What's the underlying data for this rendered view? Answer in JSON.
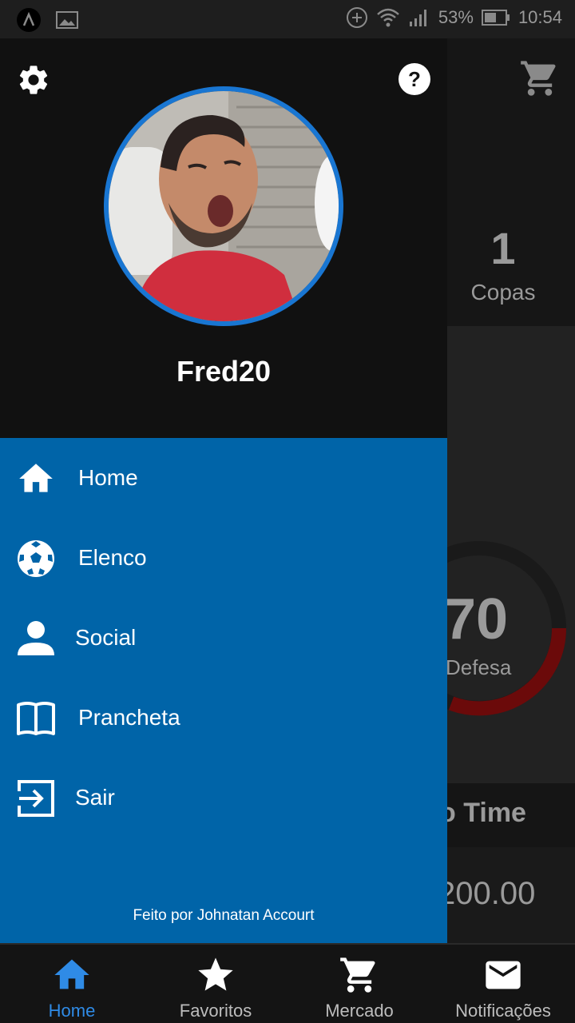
{
  "status_bar": {
    "battery": "53%",
    "time": "10:54"
  },
  "background": {
    "copas_count": "1",
    "copas_label": "Copas",
    "gauge_value": "70",
    "gauge_label": "Defesa",
    "section_title": "o Time",
    "amount": "200.00",
    "gauge_color": "#8b0000"
  },
  "drawer": {
    "username": "Fred20",
    "avatar_border_color": "#1976d2",
    "menu": [
      {
        "label": "Home",
        "icon": "home-icon"
      },
      {
        "label": "Elenco",
        "icon": "soccer-ball-icon"
      },
      {
        "label": "Social",
        "icon": "person-icon"
      },
      {
        "label": "Prancheta",
        "icon": "book-icon"
      },
      {
        "label": "Sair",
        "icon": "exit-icon"
      }
    ],
    "credit": "Feito por Johnatan Accourt",
    "menu_bg_color": "#0064a8"
  },
  "bottom_nav": {
    "items": [
      {
        "label": "Home",
        "icon": "home-icon",
        "active": true
      },
      {
        "label": "Favoritos",
        "icon": "star-icon",
        "active": false
      },
      {
        "label": "Mercado",
        "icon": "cart-icon",
        "active": false
      },
      {
        "label": "Notificações",
        "icon": "mail-icon",
        "active": false
      }
    ],
    "active_color": "#2f8be6"
  }
}
